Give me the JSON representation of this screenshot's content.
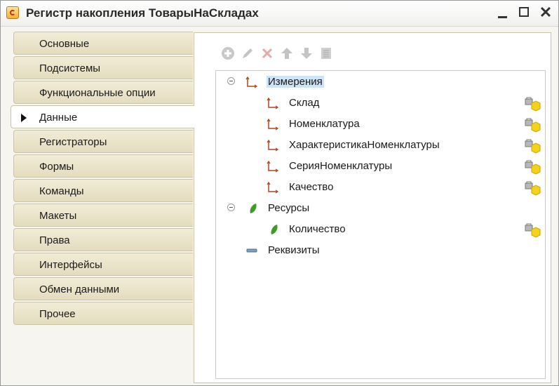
{
  "window": {
    "title": "Регистр накопления ТоварыНаСкладах",
    "controls": [
      "minimize",
      "maximize",
      "close"
    ]
  },
  "sidebar": {
    "active_index": 3,
    "items": [
      {
        "label": "Основные"
      },
      {
        "label": "Подсистемы"
      },
      {
        "label": "Функциональные опции"
      },
      {
        "label": "Данные"
      },
      {
        "label": "Регистраторы"
      },
      {
        "label": "Формы"
      },
      {
        "label": "Команды"
      },
      {
        "label": "Макеты"
      },
      {
        "label": "Права"
      },
      {
        "label": "Интерфейсы"
      },
      {
        "label": "Обмен данными"
      },
      {
        "label": "Прочее"
      }
    ]
  },
  "toolbar": {
    "buttons": [
      {
        "icon": "add-icon"
      },
      {
        "icon": "edit-icon"
      },
      {
        "icon": "delete-icon"
      },
      {
        "icon": "move-up-icon"
      },
      {
        "icon": "move-down-icon"
      },
      {
        "icon": "sort-icon"
      }
    ]
  },
  "tree": {
    "dimensions": {
      "label": "Измерения",
      "children": [
        {
          "label": "Склад"
        },
        {
          "label": "Номенклатура"
        },
        {
          "label": "ХарактеристикаНоменклатуры"
        },
        {
          "label": "СерияНоменклатуры"
        },
        {
          "label": "Качество"
        }
      ]
    },
    "resources": {
      "label": "Ресурсы",
      "children": [
        {
          "label": "Количество"
        }
      ]
    },
    "attributes": {
      "label": "Реквизиты"
    }
  },
  "colors": {
    "selection": "#cde3f7",
    "tab_bg": "#e8e2c8",
    "dimension_icon": "#b0451e",
    "resource_icon": "#3f9a2a"
  }
}
